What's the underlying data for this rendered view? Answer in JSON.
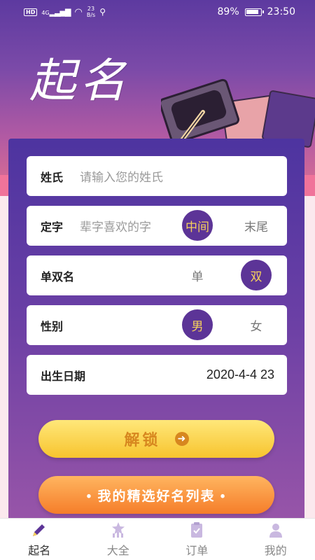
{
  "status": {
    "hd": "HD",
    "signal": "4G",
    "speed_top": "23",
    "speed_unit": "B/s",
    "battery": "89%",
    "time": "23:50"
  },
  "title": "起名",
  "form": {
    "surname": {
      "label": "姓氏",
      "placeholder": "请输入您的姓氏"
    },
    "fixed_char": {
      "label": "定字",
      "placeholder": "辈字喜欢的字",
      "options": [
        "中间",
        "末尾"
      ],
      "selected": "中间"
    },
    "name_length": {
      "label": "单双名",
      "options": [
        "单",
        "双"
      ],
      "selected": "双"
    },
    "gender": {
      "label": "性别",
      "options": [
        "男",
        "女"
      ],
      "selected": "男"
    },
    "birth_date": {
      "label": "出生日期",
      "value": "2020-4-4 23"
    }
  },
  "buttons": {
    "unlock": "解锁",
    "favorites": "• 我的精选好名列表 •"
  },
  "tabs": [
    {
      "label": "起名",
      "icon": "pencil-icon",
      "active": true
    },
    {
      "label": "大全",
      "icon": "star-chart-icon",
      "active": false
    },
    {
      "label": "订单",
      "icon": "clipboard-icon",
      "active": false
    },
    {
      "label": "我的",
      "icon": "user-icon",
      "active": false
    }
  ],
  "colors": {
    "primary": "#5c3497",
    "accent_yellow": "#f6d15c",
    "unlock_text": "#d7871f",
    "list_button": "#f57d2a"
  }
}
